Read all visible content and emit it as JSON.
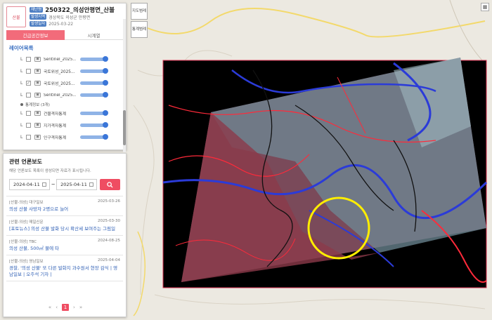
{
  "header": {
    "thumb_label": "산불",
    "badge_id": "재난명",
    "title": "250322_의성안평면_산불",
    "badge_region": "발생지역",
    "region": "경상북도 의성군 안평면",
    "badge_date": "발생일자",
    "date": "2025-03-22"
  },
  "tabs": [
    {
      "label": "긴급공간정보"
    },
    {
      "label": "시계열"
    }
  ],
  "layers": {
    "title": "레이어목록",
    "items": [
      {
        "name": "Sentinel_2025..."
      },
      {
        "name": "Sentinel_2025..."
      },
      {
        "name": "국토위성_2025..."
      },
      {
        "name": "국토위성_2025..."
      },
      {
        "name": "Sentinel_2025..."
      }
    ],
    "group_label": "통계정보 (3개)",
    "stats": [
      {
        "name": "건물격자통계"
      },
      {
        "name": "지가격자통계"
      },
      {
        "name": "인구격자통계"
      }
    ],
    "L": "L"
  },
  "news": {
    "title": "관련 언론보도",
    "desc": "해당 언론보도 목록이 생성되면 자료가 표시됩니다.",
    "date_from": "2024-04-11",
    "date_to": "2025-04-11",
    "tilde": "~",
    "items": [
      {
        "source": "[산불-의성] 대구일보",
        "date": "2025-03-26",
        "headline": "의성 산불 사망자 2명으로 늘어"
      },
      {
        "source": "[산불-의성] 매일신문",
        "date": "2025-03-30",
        "headline": "[포토뉴스] 의성 산불 발화 당시 확산세 보여주는 그림일"
      },
      {
        "source": "[산불-의성] TBC",
        "date": "2024-08-25",
        "headline": "의성 산불, 500㎡ 불에 타"
      },
      {
        "source": "[산불-의성] 영남일보",
        "date": "2025-04-04",
        "headline": "경찰, '의성 산불' 또 다른 발화지 과수원서 현장 감식 | 영남일보 | 오주석 기자 |"
      }
    ],
    "pager": {
      "first": "«",
      "prev": "‹",
      "current": "1",
      "next": "›",
      "last": "»"
    }
  },
  "map": {
    "btn_map": "지도범례",
    "btn_stats": "통계범례"
  }
}
